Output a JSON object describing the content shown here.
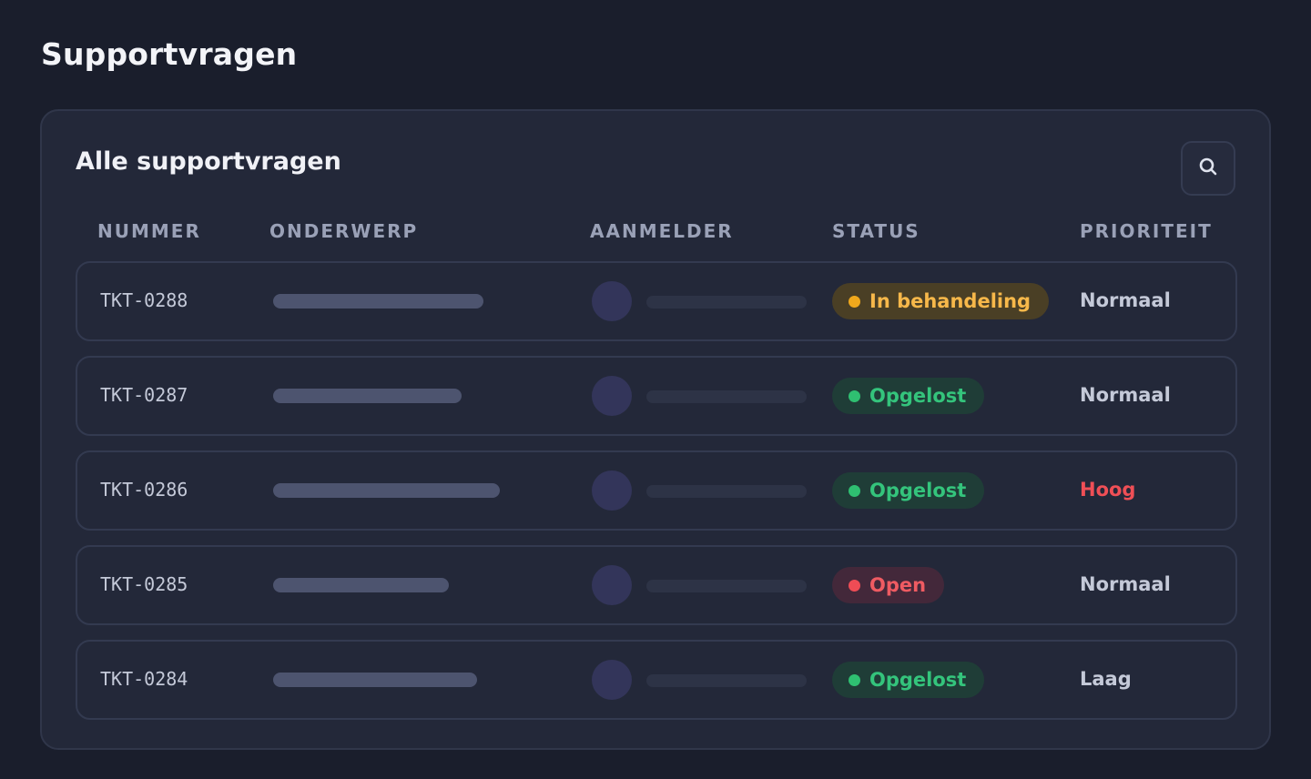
{
  "page": {
    "title": "Supportvragen"
  },
  "card": {
    "title": "Alle supportvragen"
  },
  "columns": [
    "NUMMER",
    "ONDERWERP",
    "AANMELDER",
    "STATUS",
    "PRIORITEIT"
  ],
  "status_styles": {
    "In behandeling": {
      "bg": "#4a3f25",
      "fg": "#f7b84a",
      "dot": "#f0a81c"
    },
    "Opgelost": {
      "bg": "#1f3d37",
      "fg": "#34c47c",
      "dot": "#2fbf71"
    },
    "Open": {
      "bg": "#43283a",
      "fg": "#ef5b62",
      "dot": "#ee4c55"
    }
  },
  "priority_colors": {
    "Normaal": "#c4c9d8",
    "Hoog": "#ef4f56",
    "Laag": "#c4c9d8"
  },
  "tickets": [
    {
      "number": "TKT-0288",
      "subject_length": 0.66,
      "status": "In behandeling",
      "priority": "Normaal"
    },
    {
      "number": "TKT-0287",
      "subject_length": 0.59,
      "status": "Opgelost",
      "priority": "Normaal"
    },
    {
      "number": "TKT-0286",
      "subject_length": 0.71,
      "status": "Opgelost",
      "priority": "Hoog"
    },
    {
      "number": "TKT-0285",
      "subject_length": 0.55,
      "status": "Open",
      "priority": "Normaal"
    },
    {
      "number": "TKT-0284",
      "subject_length": 0.64,
      "status": "Opgelost",
      "priority": "Laag"
    }
  ]
}
